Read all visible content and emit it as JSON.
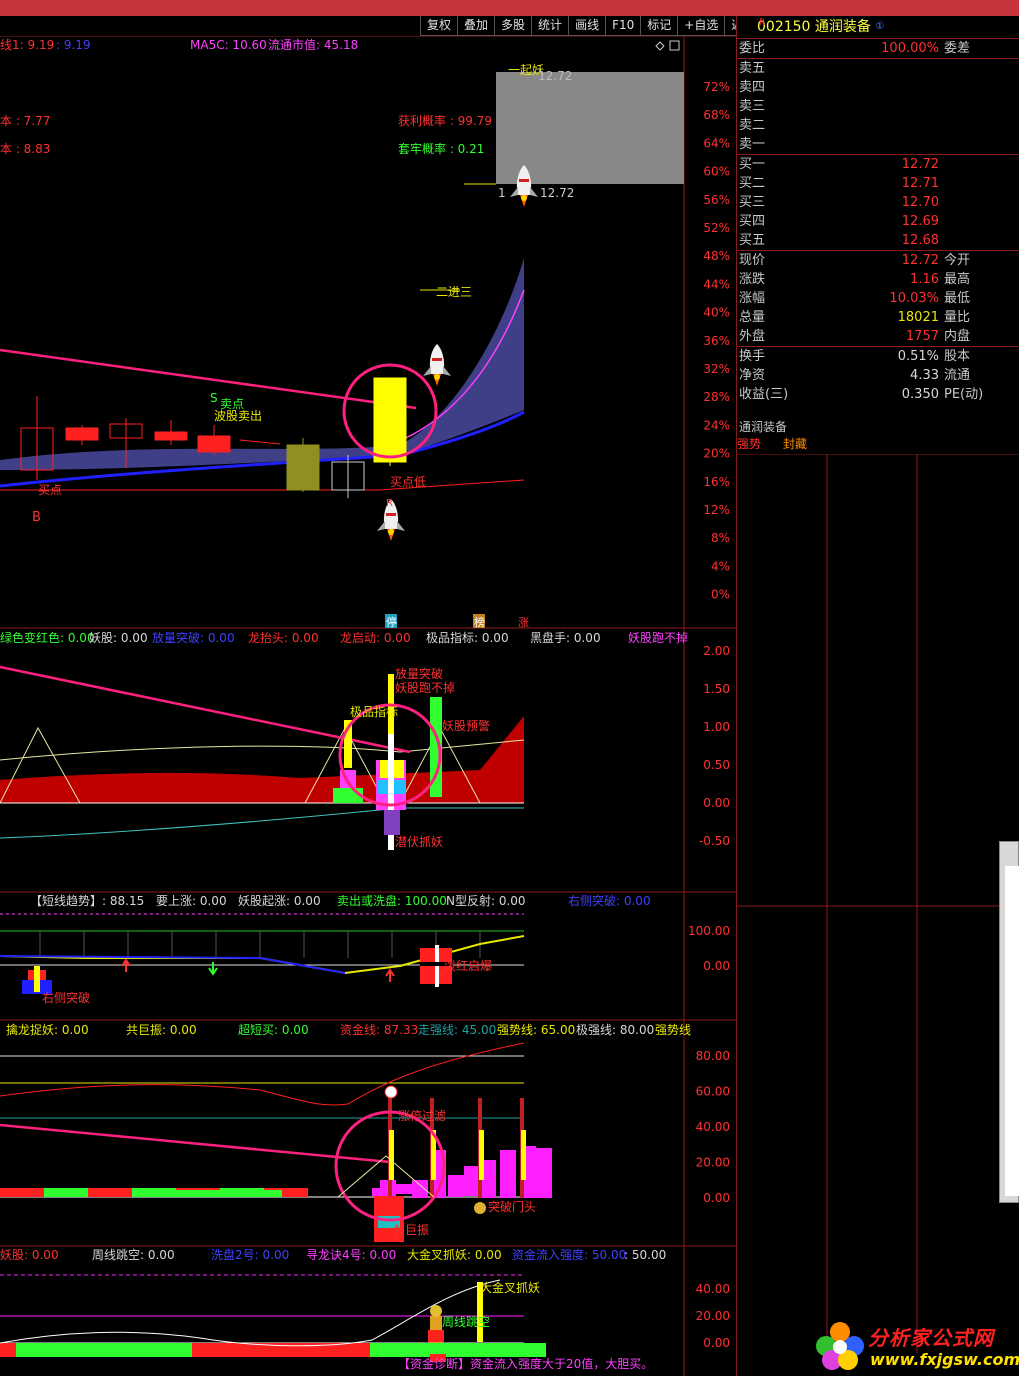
{
  "toolbar": {
    "buttons": [
      "复权",
      "叠加",
      "多股",
      "统计",
      "画线",
      "F10",
      "标记",
      "+自选",
      "返回"
    ]
  },
  "main_panel": {
    "header": {
      "ma1": "线1: 9.19",
      "ma1b": ": 9.19",
      "ma5c": "MA5C: 10.60",
      "float_cap": "流通市值: 45.18"
    },
    "left_labels": [
      "本 : 7.77",
      "本 : 8.83"
    ],
    "prob": {
      "profit": "获利概率 : 99.79",
      "trapped": "套牢概率 : 0.21"
    },
    "annotations": {
      "qiyao": "一起妖",
      "top_price": "12.72",
      "arrow_price": "12.72",
      "erjinsan": "二进三",
      "s_point": "S",
      "sell_point": "卖点",
      "wave_sell": "波股卖出",
      "buy_dot": "买点",
      "b_mark": "B",
      "buy_point2": "买点低",
      "rocket_label": "R",
      "tick_one": "1"
    },
    "pct_axis": [
      "72%",
      "68%",
      "64%",
      "60%",
      "56%",
      "52%",
      "48%",
      "44%",
      "40%",
      "36%",
      "32%",
      "28%",
      "24%",
      "20%",
      "16%",
      "12%",
      "8%",
      "4%",
      "0%"
    ],
    "bottom_tags": {
      "t1": "停",
      "t2": "榜",
      "t3": "涨"
    }
  },
  "panel2": {
    "header": [
      {
        "text": "绿色变红色: 0.00",
        "color": "#30ff30"
      },
      {
        "text": "妖股: 0.00",
        "color": "#d8d8d8"
      },
      {
        "text": "放量突破: 0.00",
        "color": "#4040ff"
      },
      {
        "text": "龙抬头: 0.00",
        "color": "#ff3030"
      },
      {
        "text": "龙启动: 0.00",
        "color": "#ff3030"
      },
      {
        "text": "极品指标: 0.00",
        "color": "#d8d8d8"
      },
      {
        "text": "黑盘手: 0.00",
        "color": "#d8d8d8"
      },
      {
        "text": "妖股跑不掉",
        "color": "#ff40ff"
      }
    ],
    "axis": [
      "2.00",
      "1.50",
      "1.00",
      "0.50",
      "0.00",
      "-0.50"
    ],
    "labels": {
      "breakout": "放量突破",
      "cant_escape": "妖股跑不掉",
      "jipin": "极品指标",
      "warning": "妖股预警",
      "hidden": "潜伏抓妖"
    }
  },
  "panel3": {
    "header": [
      {
        "text": "【短线趋势】: 88.15",
        "color": "#d8d8d8"
      },
      {
        "text": "要上涨: 0.00",
        "color": "#d8d8d8"
      },
      {
        "text": "妖股起涨: 0.00",
        "color": "#d8d8d8"
      },
      {
        "text": "卖出或洗盘: 100.00",
        "color": "#30ff30"
      },
      {
        "text": "N型反射: 0.00",
        "color": "#d8d8d8"
      },
      {
        "text": "右侧突破: 0.00",
        "color": "#4040ff"
      }
    ],
    "axis": [
      "100.00",
      "0.00"
    ],
    "labels": {
      "right_break": "右侧突破",
      "start": "泼红启爆"
    }
  },
  "panel4": {
    "header": [
      {
        "text": "擒龙捉妖: 0.00",
        "color": "#e8e800"
      },
      {
        "text": "共巨振: 0.00",
        "color": "#e8e800"
      },
      {
        "text": "超短买: 0.00",
        "color": "#30ff30"
      },
      {
        "text": "资金线: 87.33",
        "color": "#ff3030"
      },
      {
        "text": "走强线: 45.00",
        "color": "#20a0a0"
      },
      {
        "text": "强势线: 65.00",
        "color": "#e8e800"
      },
      {
        "text": "极强线: 80.00",
        "color": "#d8d8d8"
      },
      {
        "text": "强势线",
        "color": "#e8e800"
      }
    ],
    "axis": [
      "80.00",
      "60.00",
      "40.00",
      "20.00",
      "0.00"
    ],
    "labels": {
      "limit_filter": "涨停过滤",
      "resonance": "共巨振",
      "break_head": "突破门头"
    }
  },
  "panel5": {
    "header": [
      {
        "text": "妖股: 0.00",
        "color": "#ff3030"
      },
      {
        "text": "周线跳空: 0.00",
        "color": "#d8d8d8"
      },
      {
        "text": "洗盘2号: 0.00",
        "color": "#4040ff"
      },
      {
        "text": "寻龙诀4号: 0.00",
        "color": "#ff40ff"
      },
      {
        "text": "大金叉抓妖: 0.00",
        "color": "#e8e800"
      },
      {
        "text": "资金流入强度: 50.00",
        "color": "#4040ff"
      },
      {
        "text": ": 50.00",
        "color": "#d8d8d8"
      }
    ],
    "axis": [
      "40.00",
      "20.00",
      "0.00"
    ],
    "labels": {
      "golden": "大金叉抓妖",
      "weekly_gap": "周线跳空",
      "diag": "【资金诊断】资金流入强度大于20值，大胆买。"
    }
  },
  "quote": {
    "code": "002150",
    "name": "通润装备",
    "r_mark": "R",
    "info_mark": "①",
    "weibi": {
      "label": "委比",
      "value": "100.00%",
      "label2": "委差"
    },
    "sells": [
      {
        "label": "卖五",
        "price": ""
      },
      {
        "label": "卖四",
        "price": ""
      },
      {
        "label": "卖三",
        "price": ""
      },
      {
        "label": "卖二",
        "price": ""
      },
      {
        "label": "卖一",
        "price": ""
      }
    ],
    "buys": [
      {
        "label": "买一",
        "price": "12.72"
      },
      {
        "label": "买二",
        "price": "12.71"
      },
      {
        "label": "买三",
        "price": "12.70"
      },
      {
        "label": "买四",
        "price": "12.69"
      },
      {
        "label": "买五",
        "price": "12.68"
      }
    ],
    "stats1": [
      {
        "label": "现价",
        "value": "12.72",
        "label2": "今开",
        "color": "#ff3030"
      },
      {
        "label": "涨跌",
        "value": "1.16",
        "label2": "最高",
        "color": "#ff3030"
      },
      {
        "label": "涨幅",
        "value": "10.03%",
        "label2": "最低",
        "color": "#ff3030"
      },
      {
        "label": "总量",
        "value": "18021",
        "label2": "量比",
        "color": "#e8e800"
      },
      {
        "label": "外盘",
        "value": "1757",
        "label2": "内盘",
        "color": "#ff3030"
      }
    ],
    "stats2": [
      {
        "label": "换手",
        "value": "0.51%",
        "label2": "股本",
        "color": "#d8d8d8"
      },
      {
        "label": "净资",
        "value": "4.33",
        "label2": "流通",
        "color": "#d8d8d8"
      },
      {
        "label": "收益(三)",
        "value": "0.350",
        "label2": "PE(动)",
        "color": "#d8d8d8"
      }
    ],
    "mini_title": "通润装备",
    "tags": [
      "强势",
      "封藏"
    ]
  },
  "watermark": {
    "line1": "分析家公式网",
    "line2": "www.fxjgsw.com"
  }
}
